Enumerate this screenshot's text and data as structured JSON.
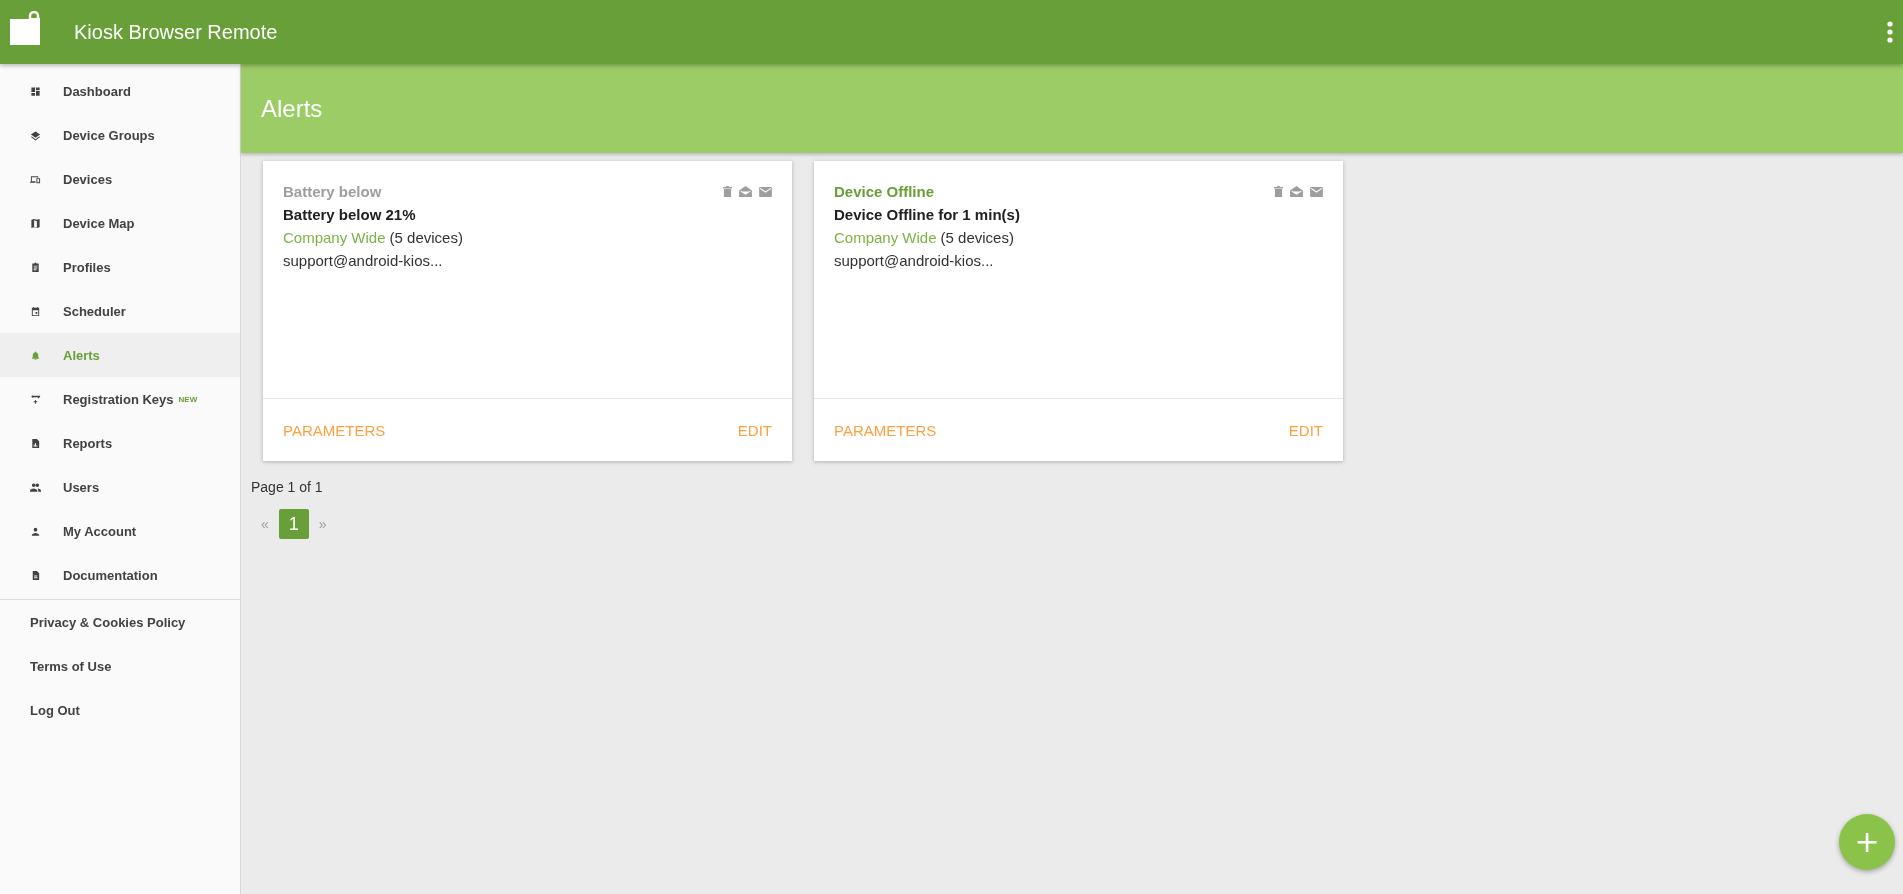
{
  "app_bar": {
    "title": "Kiosk Browser Remote"
  },
  "sidebar": {
    "items": [
      {
        "label": "Dashboard",
        "selected": false
      },
      {
        "label": "Device Groups",
        "selected": false
      },
      {
        "label": "Devices",
        "selected": false
      },
      {
        "label": "Device Map",
        "selected": false
      },
      {
        "label": "Profiles",
        "selected": false
      },
      {
        "label": "Scheduler",
        "selected": false
      },
      {
        "label": "Alerts",
        "selected": true
      },
      {
        "label": "Registration Keys",
        "selected": false,
        "badge": "NEW"
      },
      {
        "label": "Reports",
        "selected": false
      },
      {
        "label": "Users",
        "selected": false
      },
      {
        "label": "My Account",
        "selected": false
      },
      {
        "label": "Documentation",
        "selected": false
      }
    ],
    "footer_links": [
      "Privacy & Cookies Policy",
      "Terms of Use",
      "Log Out"
    ]
  },
  "page_title": "Alerts",
  "alerts": [
    {
      "name": "Battery below",
      "active": false,
      "description": "Battery below 21%",
      "scope": "Company Wide",
      "device_count": "(5 devices)",
      "recipient": "support@android-kios...",
      "actions": [
        "PARAMETERS",
        "EDIT"
      ]
    },
    {
      "name": "Device Offline",
      "active": true,
      "description": "Device Offline for 1 min(s)",
      "scope": "Company Wide",
      "device_count": "(5 devices)",
      "recipient": "support@android-kios...",
      "actions": [
        "PARAMETERS",
        "EDIT"
      ]
    }
  ],
  "pagination": {
    "summary": "Page 1 of 1",
    "prev": "«",
    "next": "»",
    "pages": [
      {
        "label": "1",
        "selected": true
      }
    ]
  },
  "fab": {
    "label": "+"
  }
}
